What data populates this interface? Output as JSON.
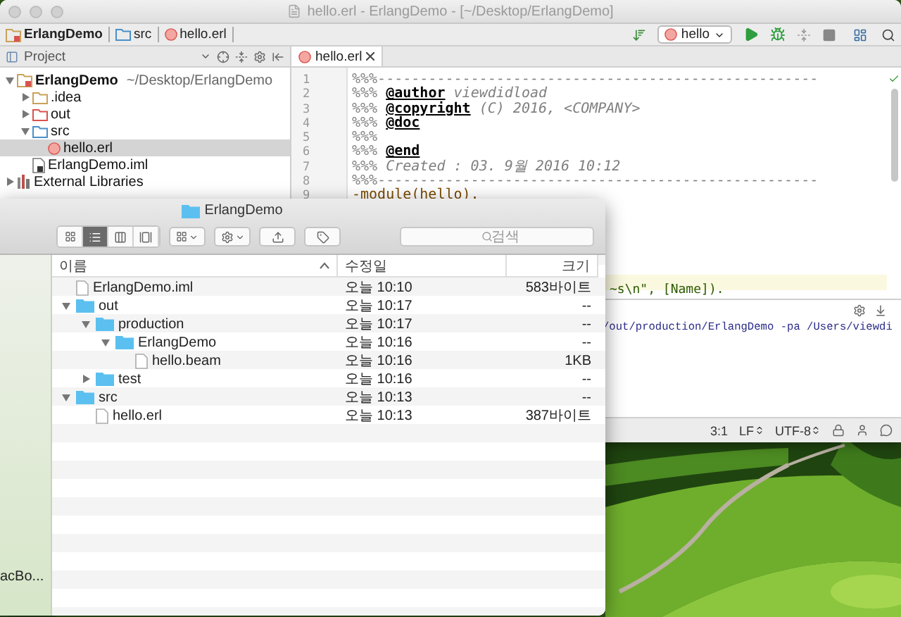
{
  "ide": {
    "title": "hello.erl - ErlangDemo - [~/Desktop/ErlangDemo]",
    "breadcrumbs": [
      {
        "label": "ErlangDemo",
        "kind": "project"
      },
      {
        "label": "src",
        "kind": "folder"
      },
      {
        "label": "hello.erl",
        "kind": "erl"
      }
    ],
    "run_config": {
      "label": "hello"
    },
    "tool_window": {
      "title": "Project"
    },
    "project_tree": [
      {
        "label": "ErlangDemo",
        "path": "~/Desktop/ErlangDemo",
        "kind": "project",
        "expanded": true,
        "selected": false,
        "children": [
          {
            "label": ".idea",
            "kind": "folder",
            "color": "#c9a25a",
            "expanded": false,
            "selected": false
          },
          {
            "label": "out",
            "kind": "folder",
            "color": "#d9534f",
            "expanded": false,
            "selected": false
          },
          {
            "label": "src",
            "kind": "folder",
            "color": "#4a90c8",
            "expanded": true,
            "selected": false,
            "children": [
              {
                "label": "hello.erl",
                "kind": "erl",
                "selected": true
              }
            ]
          },
          {
            "label": "ErlangDemo.iml",
            "kind": "iml",
            "selected": false
          }
        ]
      },
      {
        "label": "External Libraries",
        "kind": "library",
        "expanded": false,
        "selected": false
      }
    ],
    "editor_tabs": [
      {
        "label": "hello.erl",
        "selected": true
      }
    ],
    "editor_lines": [
      {
        "number": "1",
        "kind": "comment",
        "text": "%%%----------------------------------------------------"
      },
      {
        "number": "2",
        "kind": "comment",
        "text": "%%% **@author** *viewdidload*"
      },
      {
        "number": "3",
        "kind": "comment",
        "text": "%%% **@copyright** *(C) 2016, <COMPANY>*"
      },
      {
        "number": "4",
        "kind": "comment",
        "text": "%%% **@doc**"
      },
      {
        "number": "5",
        "kind": "comment",
        "text": "%%%"
      },
      {
        "number": "6",
        "kind": "comment",
        "text": "%%% **@end**"
      },
      {
        "number": "7",
        "kind": "comment",
        "text": "%%% *Created : 03. 9월 2016 10:12*"
      },
      {
        "number": "8",
        "kind": "comment",
        "text": "%%%----------------------------------------------------"
      },
      {
        "number": "9",
        "kind": "code",
        "text": "-module(hello)."
      }
    ],
    "current_line_tail": {
      "text": "~s\\n\", [Name]).",
      "current": true
    },
    "console": {
      "text": "/out/production/ErlangDemo -pa /Users/viewdi"
    },
    "status": {
      "position": "3:1",
      "line_separator": "LF",
      "encoding": "UTF-8"
    }
  },
  "finder": {
    "title": "ErlangDemo",
    "view_modes": [
      {
        "kind": "icons",
        "selected": false
      },
      {
        "kind": "list",
        "selected": true
      },
      {
        "kind": "columns",
        "selected": false
      },
      {
        "kind": "gallery",
        "selected": false
      }
    ],
    "search": {
      "placeholder": "검색"
    },
    "columns": [
      {
        "label": "이름",
        "sorted": true
      },
      {
        "label": "수정일",
        "sorted": false
      },
      {
        "label": "크기",
        "sorted": false
      }
    ],
    "sidebar": [
      {
        "label": "acBo..."
      }
    ],
    "rows": [
      {
        "name": "ErlangDemo.iml",
        "kind": "file",
        "modified": "오늘 10:10",
        "size": "583바이트"
      },
      {
        "name": "out",
        "kind": "folder",
        "expanded": true,
        "modified": "오늘 10:17",
        "size": "--",
        "children": [
          {
            "name": "production",
            "kind": "folder",
            "expanded": true,
            "modified": "오늘 10:17",
            "size": "--",
            "children": [
              {
                "name": "ErlangDemo",
                "kind": "folder",
                "expanded": true,
                "modified": "오늘 10:16",
                "size": "--",
                "children": [
                  {
                    "name": "hello.beam",
                    "kind": "file",
                    "modified": "오늘 10:16",
                    "size": "1KB"
                  }
                ]
              }
            ]
          },
          {
            "name": "test",
            "kind": "folder",
            "expanded": false,
            "modified": "오늘 10:16",
            "size": "--"
          }
        ]
      },
      {
        "name": "src",
        "kind": "folder",
        "expanded": true,
        "modified": "오늘 10:13",
        "size": "--",
        "children": [
          {
            "name": "hello.erl",
            "kind": "file",
            "modified": "오늘 10:13",
            "size": "387바이트"
          }
        ]
      }
    ]
  }
}
